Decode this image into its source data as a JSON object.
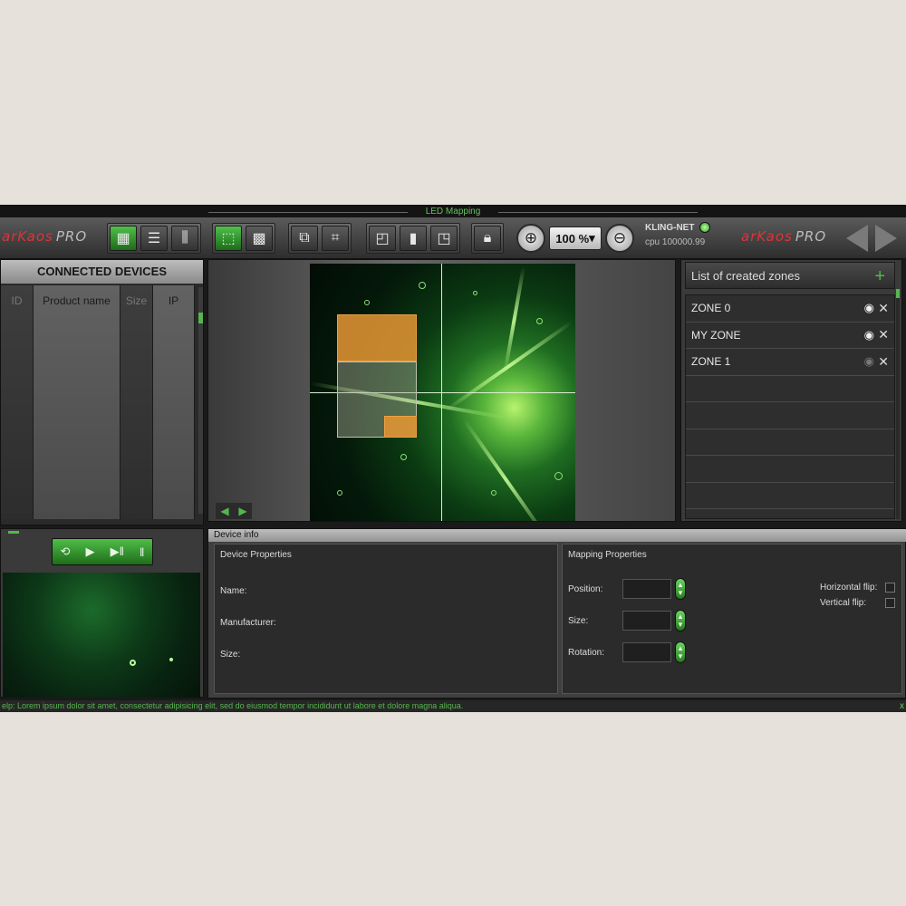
{
  "window": {
    "title": "LED Mapping"
  },
  "toolbar": {
    "logo_brand": "arKaos",
    "logo_pro": "PRO",
    "zoom_value": "100 %",
    "zoom_caret": "▾",
    "network_label": "KLING-NET",
    "cpu_label": "cpu  100000.99",
    "icons": [
      "device-grid-icon",
      "device-list-icon",
      "sliders-icon",
      "zone-select-icon",
      "led-grid-icon",
      "transform-icon",
      "crop-icon",
      "page-back-icon",
      "page-icon",
      "page-add-icon",
      "lock-icon",
      "zoom-in-icon",
      "zoom-out-icon",
      "prev-arrow-icon",
      "next-arrow-icon"
    ]
  },
  "devices": {
    "title": "CONNECTED DEVICES",
    "columns": [
      "ID",
      "Product name",
      "Size",
      "IP"
    ]
  },
  "transport": {
    "icons": [
      "play-loop-icon",
      "play-icon",
      "play-pause-icon",
      "pause-icon"
    ]
  },
  "zones": {
    "title": "List of created zones",
    "add_icon": "+",
    "items": [
      {
        "label": "ZONE 0",
        "visible": true
      },
      {
        "label": "MY ZONE",
        "visible": true
      },
      {
        "label": "ZONE 1",
        "visible": false
      }
    ]
  },
  "device_info": {
    "title": "Device info",
    "device_properties": {
      "title": "Device Properties",
      "name_label": "Name:",
      "manufacturer_label": "Manufacturer:",
      "size_label": "Size:"
    },
    "mapping_properties": {
      "title": "Mapping Properties",
      "position_label": "Position:",
      "size_label": "Size:",
      "rotation_label": "Rotation:",
      "hflip_label": "Horizontal flip:",
      "vflip_label": "Vertical flip:"
    }
  },
  "help": {
    "text": "elp: Lorem ipsum dolor sit amet, consectetur adipisicing elit, sed do eiusmod tempor incididunt ut labore et dolore magna aliqua.",
    "close": "x"
  },
  "colors": {
    "accent_green": "#55b64e",
    "brand_red": "#d7363b",
    "zone_orange": "#e6963a"
  }
}
